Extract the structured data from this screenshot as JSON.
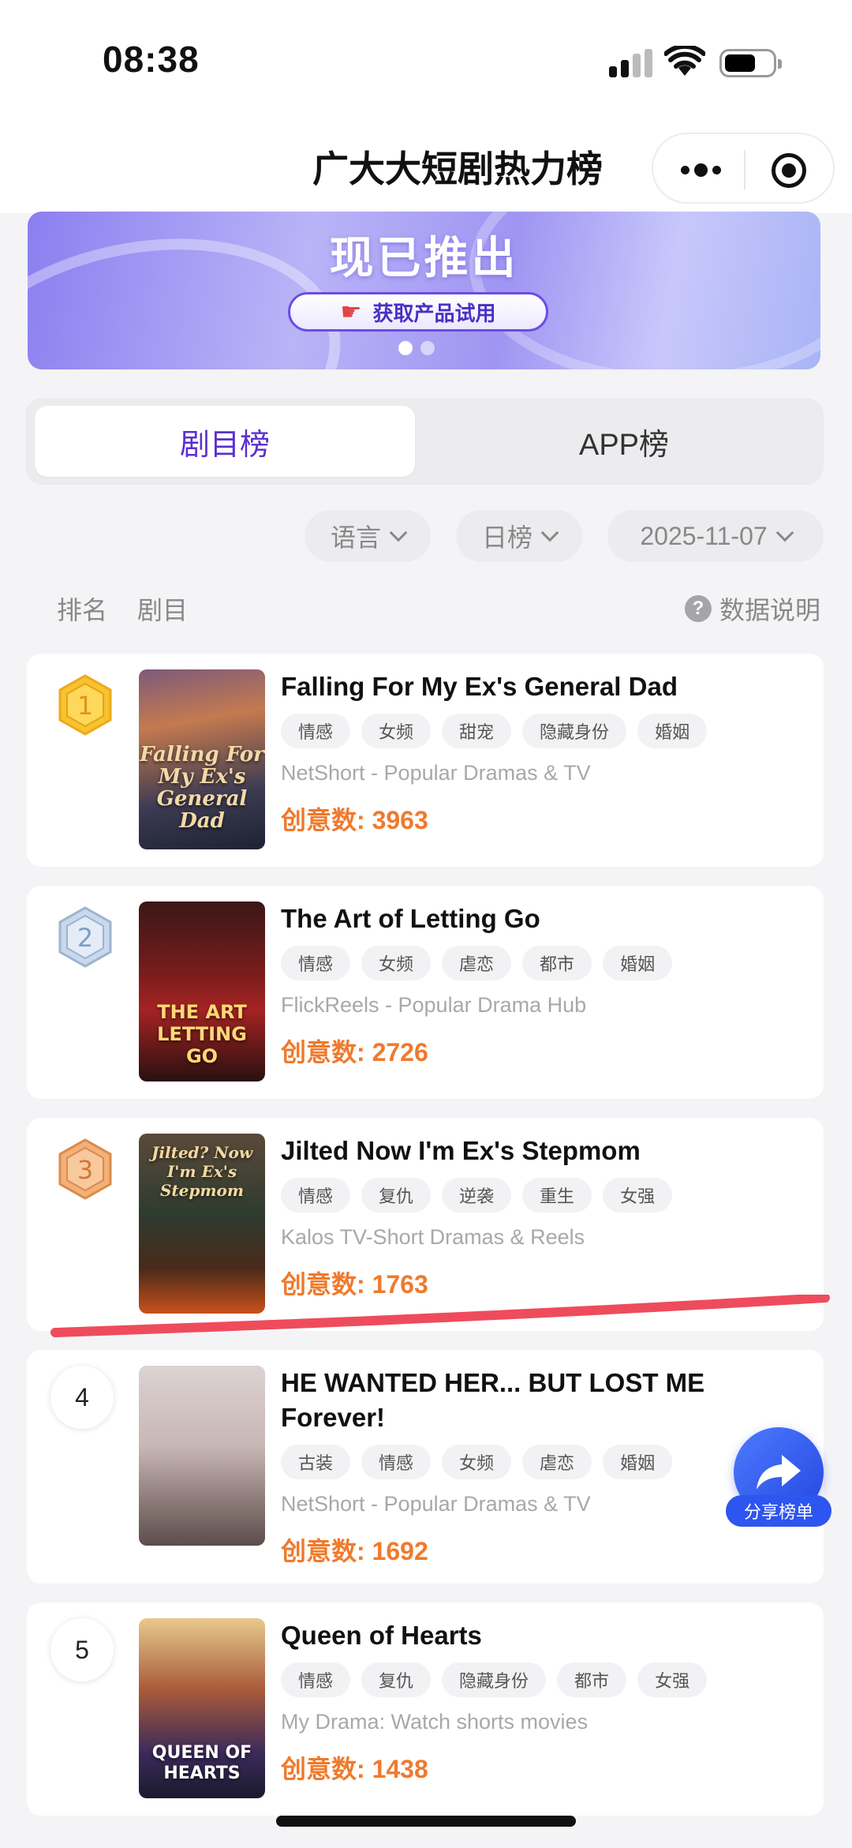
{
  "status_bar": {
    "time": "08:38"
  },
  "header": {
    "title": "广大大短剧热力榜"
  },
  "banner": {
    "headline": "现已推出",
    "cta_label": "获取产品试用"
  },
  "tabs": [
    {
      "label": "剧目榜",
      "active": true
    },
    {
      "label": "APP榜",
      "active": false
    }
  ],
  "filters": {
    "language": "语言",
    "period": "日榜",
    "date": "2025-11-07"
  },
  "columns": {
    "rank": "排名",
    "drama": "剧目",
    "data_note": "数据说明"
  },
  "count_label": "创意数: ",
  "dramas": [
    {
      "rank": "1",
      "title": "Falling For My Ex's General Dad",
      "tags": [
        "情感",
        "女频",
        "甜宠",
        "隐藏身份",
        "婚姻"
      ],
      "app": "NetShort - Popular Dramas & TV",
      "count": "3963",
      "poster_text": "Falling For My Ex's General Dad"
    },
    {
      "rank": "2",
      "title": "The Art of Letting Go",
      "tags": [
        "情感",
        "女频",
        "虐恋",
        "都市",
        "婚姻"
      ],
      "app": "FlickReels - Popular Drama Hub",
      "count": "2726",
      "poster_text": "THE ART LETTING GO"
    },
    {
      "rank": "3",
      "title": "Jilted Now I'm Ex's Stepmom",
      "tags": [
        "情感",
        "复仇",
        "逆袭",
        "重生",
        "女强"
      ],
      "app": "Kalos TV-Short Dramas & Reels",
      "count": "1763",
      "poster_text": "Jilted? Now I'm Ex's Stepmom"
    },
    {
      "rank": "4",
      "title": "HE WANTED HER... BUT LOST ME Forever!",
      "tags": [
        "古装",
        "情感",
        "女频",
        "虐恋",
        "婚姻"
      ],
      "app": "NetShort - Popular Dramas & TV",
      "count": "1692",
      "poster_text": ""
    },
    {
      "rank": "5",
      "title": "Queen of Hearts",
      "tags": [
        "情感",
        "复仇",
        "隐藏身份",
        "都市",
        "女强"
      ],
      "app": "My Drama: Watch shorts movies",
      "count": "1438",
      "poster_text": "QUEEN OF HEARTS"
    }
  ],
  "share": {
    "label": "分享榜单"
  },
  "colors": {
    "accent": "#5b2fd0",
    "count": "#f07a2c",
    "share": "#2d55f0",
    "annotation": "#ee4c5c"
  }
}
